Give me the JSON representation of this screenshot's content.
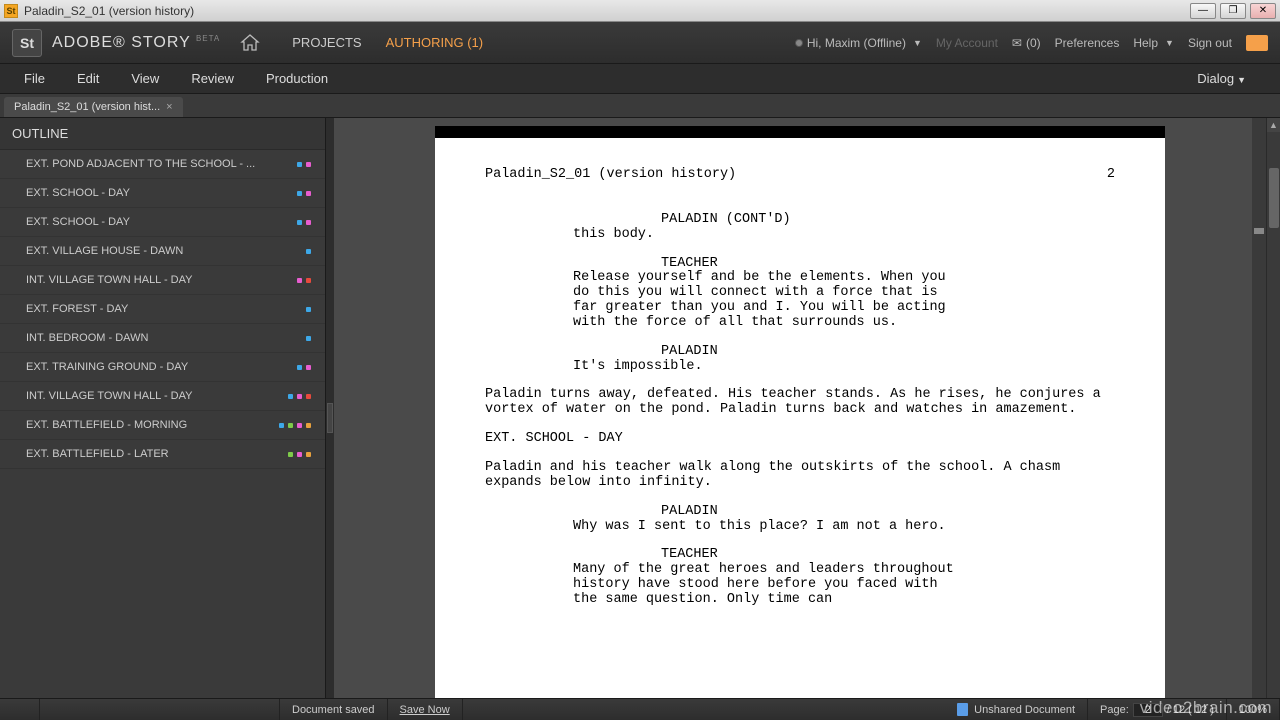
{
  "window": {
    "title": "Paladin_S2_01 (version history)"
  },
  "brand": {
    "logo": "St",
    "name": "ADOBE® STORY",
    "beta": "BETA"
  },
  "nav": {
    "projects": "PROJECTS",
    "authoring": "AUTHORING (1)"
  },
  "user": {
    "greeting": "Hi, Maxim (Offline)",
    "myaccount": "My Account",
    "mail_count": "(0)",
    "preferences": "Preferences",
    "help": "Help",
    "signout": "Sign out"
  },
  "menu": {
    "file": "File",
    "edit": "Edit",
    "view": "View",
    "review": "Review",
    "production": "Production",
    "dialog": "Dialog"
  },
  "tab": {
    "label": "Paladin_S2_01 (version hist..."
  },
  "outline": {
    "title": "OUTLINE",
    "items": [
      {
        "label": "EXT. POND ADJACENT TO THE SCHOOL - ...",
        "dots": [
          "#3da8e8",
          "#e85dd0"
        ]
      },
      {
        "label": "EXT. SCHOOL - DAY",
        "dots": [
          "#3da8e8",
          "#e85dd0"
        ]
      },
      {
        "label": "EXT. SCHOOL - DAY",
        "dots": [
          "#3da8e8",
          "#e85dd0"
        ]
      },
      {
        "label": "EXT. VILLAGE HOUSE - DAWN",
        "dots": [
          "#3da8e8"
        ]
      },
      {
        "label": "INT. VILLAGE TOWN HALL - DAY",
        "dots": [
          "#e85dd0",
          "#e84a3d"
        ]
      },
      {
        "label": "EXT. FOREST - DAY",
        "dots": [
          "#3da8e8"
        ]
      },
      {
        "label": "INT. BEDROOM - DAWN",
        "dots": [
          "#3da8e8"
        ]
      },
      {
        "label": "EXT. TRAINING GROUND - DAY",
        "dots": [
          "#3da8e8",
          "#e85dd0"
        ]
      },
      {
        "label": "INT. VILLAGE TOWN HALL - DAY",
        "dots": [
          "#3da8e8",
          "#e85dd0",
          "#e84a3d"
        ]
      },
      {
        "label": "EXT. BATTLEFIELD - MORNING",
        "dots": [
          "#3da8e8",
          "#7ecb4a",
          "#e85dd0",
          "#e8a13d"
        ]
      },
      {
        "label": "EXT. BATTLEFIELD - LATER",
        "dots": [
          "#7ecb4a",
          "#e85dd0",
          "#e8a13d"
        ]
      }
    ]
  },
  "script": {
    "doc_title": "Paladin_S2_01 (version history)",
    "page_no": "2",
    "blocks": [
      {
        "type": "character",
        "text": "PALADIN (CONT'D)"
      },
      {
        "type": "dialogue",
        "text": "this body."
      },
      {
        "type": "character",
        "text": "TEACHER"
      },
      {
        "type": "dialogue",
        "text": "Release yourself and be the elements. When you do this you will connect with a force that is far greater than you and I. You will be acting with the force of all that surrounds us."
      },
      {
        "type": "character",
        "text": "PALADIN"
      },
      {
        "type": "dialogue",
        "text": "It's impossible."
      },
      {
        "type": "action",
        "text": "Paladin turns away, defeated. His teacher stands. As he rises, he conjures a vortex of water on the pond. Paladin turns back and watches in amazement."
      },
      {
        "type": "scene-heading",
        "text": "EXT. SCHOOL - DAY"
      },
      {
        "type": "action",
        "text": "Paladin and his teacher walk along the outskirts of the school. A chasm expands below into infinity."
      },
      {
        "type": "character",
        "text": "PALADIN"
      },
      {
        "type": "dialogue",
        "text": "Why was I sent to this place? I am not a hero."
      },
      {
        "type": "character",
        "text": "TEACHER"
      },
      {
        "type": "dialogue",
        "text": "Many of the great heroes and leaders throughout history have stood here before you faced with the same question. Only time can"
      }
    ]
  },
  "status": {
    "saved": "Document saved",
    "save_now": "Save Now",
    "unshared": "Unshared Document",
    "page_label": "Page:",
    "page_current": "2",
    "page_total": "/ 12 ( 12 )",
    "zoom": "100%"
  },
  "watermark": "video2brain.com"
}
